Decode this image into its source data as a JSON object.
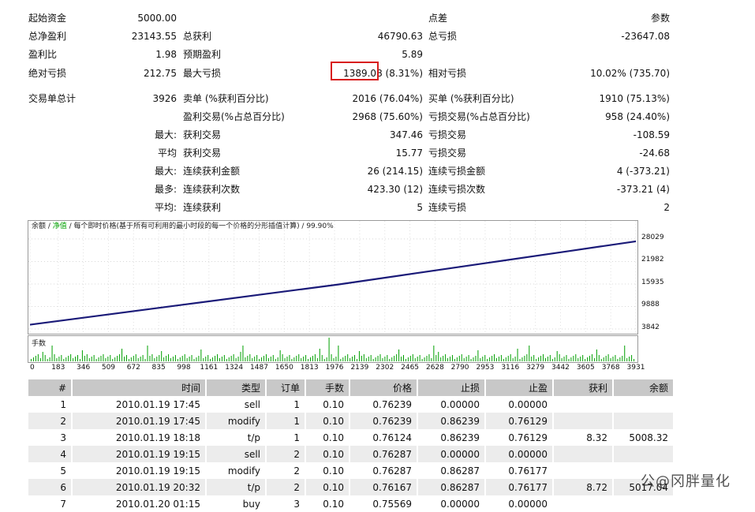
{
  "summary": {
    "row1": {
      "l1": "起始资金",
      "v1": "5000.00",
      "l3": "点差",
      "v3": "参数"
    },
    "row2": {
      "l1": "总净盈利",
      "v1": "23143.55",
      "l2": "总获利",
      "v2": "46790.63",
      "l3": "总亏损",
      "v3": "-23647.08"
    },
    "row3": {
      "l1": "盈利比",
      "v1": "1.98",
      "l2": "预期盈利",
      "v2": "5.89"
    },
    "row4": {
      "l1": "绝对亏损",
      "v1": "212.75",
      "l2": "最大亏损",
      "v2": "1389.08 (8.31%)",
      "l3": "相对亏损",
      "v3": "10.02% (735.70)"
    },
    "row5": {
      "l1": "交易单总计",
      "v1": "3926",
      "l2": "卖单 (%获利百分比)",
      "v2": "2016 (76.04%)",
      "l3": "买单 (%获利百分比)",
      "v3": "1910 (75.13%)"
    },
    "row6": {
      "l2": "盈利交易(%占总百分比)",
      "v2": "2968 (75.60%)",
      "l3": "亏损交易(%占总百分比)",
      "v3": "958 (24.40%)"
    },
    "row7": {
      "p": "最大:",
      "l2": "获利交易",
      "v2": "347.46",
      "l3": "亏损交易",
      "v3": "-108.59"
    },
    "row8": {
      "p": "平均",
      "l2": "获利交易",
      "v2": "15.77",
      "l3": "亏损交易",
      "v3": "-24.68"
    },
    "row9": {
      "p": "最大:",
      "l2": "连续获利金额",
      "v2": "26 (214.15)",
      "l3": "连续亏损金额",
      "v3": "4 (-373.21)"
    },
    "row10": {
      "p": "最多:",
      "l2": "连续获利次数",
      "v2": "423.30 (12)",
      "l3": "连续亏损次数",
      "v3": "-373.21 (4)"
    },
    "row11": {
      "p": "平均:",
      "l2": "连续获利",
      "v2": "5",
      "l3": "连续亏损",
      "v3": "2"
    }
  },
  "chart_data": {
    "type": "line",
    "legend_balance": "余额",
    "legend_sep1": " / ",
    "legend_equity": "净值",
    "legend_rest": " / 每个即时价格(基于所有可利用的最小时段的每一个价格的分形插值计算) / 99.90%",
    "series": [
      {
        "name": "余额",
        "x": [
          0,
          500,
          1000,
          1500,
          2000,
          2500,
          3000,
          3500,
          3931
        ],
        "y": [
          5000,
          7700,
          10400,
          13100,
          15800,
          18800,
          21800,
          24800,
          27400
        ]
      }
    ],
    "y_ticks": [
      "28029",
      "21982",
      "15935",
      "9888",
      "3842"
    ],
    "y_tick_values": [
      28029,
      21982,
      15935,
      9888,
      3842
    ],
    "ylim": [
      3842,
      29500
    ],
    "x_ticks": [
      "0",
      "183",
      "346",
      "509",
      "672",
      "835",
      "998",
      "1161",
      "1324",
      "1487",
      "1650",
      "1813",
      "1976",
      "2139",
      "2302",
      "2465",
      "2628",
      "2790",
      "2953",
      "3116",
      "3279",
      "3442",
      "3605",
      "3768",
      "3931"
    ],
    "xlim": [
      0,
      3931
    ],
    "volume_label": "手数",
    "line_color": "#1a1a78",
    "volume_color": "#00a000"
  },
  "table": {
    "headers": [
      "#",
      "时间",
      "类型",
      "订单",
      "手数",
      "价格",
      "止损",
      "止盈",
      "获利",
      "余额"
    ],
    "rows": [
      [
        "1",
        "2010.01.19 17:45",
        "sell",
        "1",
        "0.10",
        "0.76239",
        "0.00000",
        "0.00000",
        "",
        ""
      ],
      [
        "2",
        "2010.01.19 17:45",
        "modify",
        "1",
        "0.10",
        "0.76239",
        "0.86239",
        "0.76129",
        "",
        ""
      ],
      [
        "3",
        "2010.01.19 18:18",
        "t/p",
        "1",
        "0.10",
        "0.76124",
        "0.86239",
        "0.76129",
        "8.32",
        "5008.32"
      ],
      [
        "4",
        "2010.01.19 19:15",
        "sell",
        "2",
        "0.10",
        "0.76287",
        "0.00000",
        "0.00000",
        "",
        ""
      ],
      [
        "5",
        "2010.01.19 19:15",
        "modify",
        "2",
        "0.10",
        "0.76287",
        "0.86287",
        "0.76177",
        "",
        ""
      ],
      [
        "6",
        "2010.01.19 20:32",
        "t/p",
        "2",
        "0.10",
        "0.76167",
        "0.86287",
        "0.76177",
        "8.72",
        "5017.04"
      ],
      [
        "7",
        "2010.01.20 01:15",
        "buy",
        "3",
        "0.10",
        "0.75569",
        "0.00000",
        "0.00000",
        "",
        ""
      ]
    ]
  },
  "watermark": "公@冈胖量化"
}
